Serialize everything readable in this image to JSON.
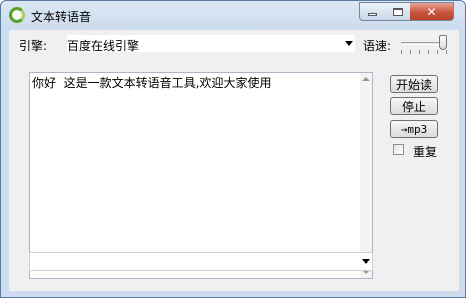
{
  "window": {
    "title": "文本转语音",
    "close_symbol": "✕"
  },
  "engine": {
    "label": "引擎:",
    "value": "百度在线引擎"
  },
  "speed": {
    "label": "语速:",
    "level": 1.0
  },
  "text_input": {
    "value": "你好  这是一款文本转语音工具,欢迎大家使用"
  },
  "buttons": {
    "start_label": "开始读",
    "stop_label": "停止",
    "mp3_label": "→mp3"
  },
  "repeat": {
    "label": "重复",
    "checked": false
  },
  "bottom_dropdown": {
    "value": ""
  }
}
